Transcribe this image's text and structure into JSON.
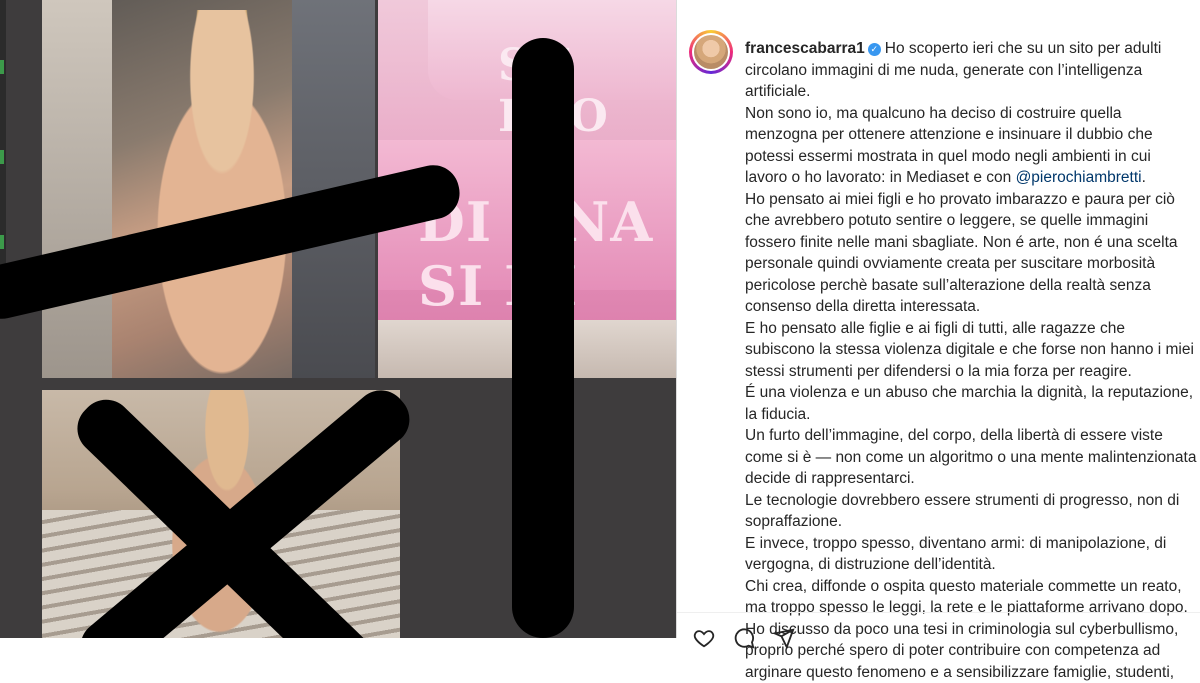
{
  "post": {
    "username": "francescabarra1",
    "verified": true,
    "caption": {
      "line_1_intro": "Ho scoperto ieri che su un sito per adulti circolano immagini di me nuda, generate con l’intelligenza artificiale.",
      "para_2": "Non sono io, ma qualcuno ha deciso di costruire quella menzogna per ottenere attenzione e insinuare il dubbio che potessi essermi mostrata in quel modo negli ambienti in cui lavoro o ho lavorato: in Mediaset e con",
      "mention": "@pierochiambretti",
      "para_2_end": ".",
      "para_3": "Ho pensato ai miei figli e ho provato imbarazzo e paura per ciò che avrebbero potuto sentire o leggere, se quelle immagini fossero finite nelle mani sbagliate. Non é arte, non é una scelta personale quindi ovviamente creata per suscitare morbosità pericolose perchè basate sull’alterazione della realtà senza consenso della diretta interessata.",
      "para_4": "E ho pensato alle figlie e ai figli di tutti, alle ragazze che subiscono la stessa violenza digitale e che forse non hanno i miei stessi strumenti per difendersi o la mia forza per reagire.",
      "para_5": "É una violenza e un abuso che marchia la dignità, la reputazione, la fiducia.",
      "para_6": "Un furto dell’immagine, del corpo, della libertà di essere viste come si è — non come un algoritmo o una mente malintenzionata decide di rappresentarci.",
      "para_7": "Le tecnologie dovrebbero essere strumenti di progresso, non di sopraffazione.",
      "para_8": "E invece, troppo spesso, diventano armi: di manipolazione, di vergogna, di distruzione dell’identità.",
      "para_9": "Chi crea, diffonde o ospita questo materiale commette un reato, ma troppo spesso le leggi, la rete e le piattaforme arrivano dopo.",
      "para_10": "Ho discusso da poco una tesi in criminologia sul cyberbullismo, proprio perché spero di poter contribuire con competenza ad arginare questo fenomeno e a sensibilizzare famiglie, studenti,"
    }
  },
  "media": {
    "cake_text_top": "SU  RLO",
    "cake_text_bottom": "DI UNA  SI DI"
  },
  "icons": {
    "like": "heart-icon",
    "comment": "comment-icon",
    "share": "share-icon",
    "verified": "verified-badge-icon"
  },
  "colors": {
    "mention": "#00376b",
    "verified": "#3897f0",
    "text": "#262626"
  }
}
